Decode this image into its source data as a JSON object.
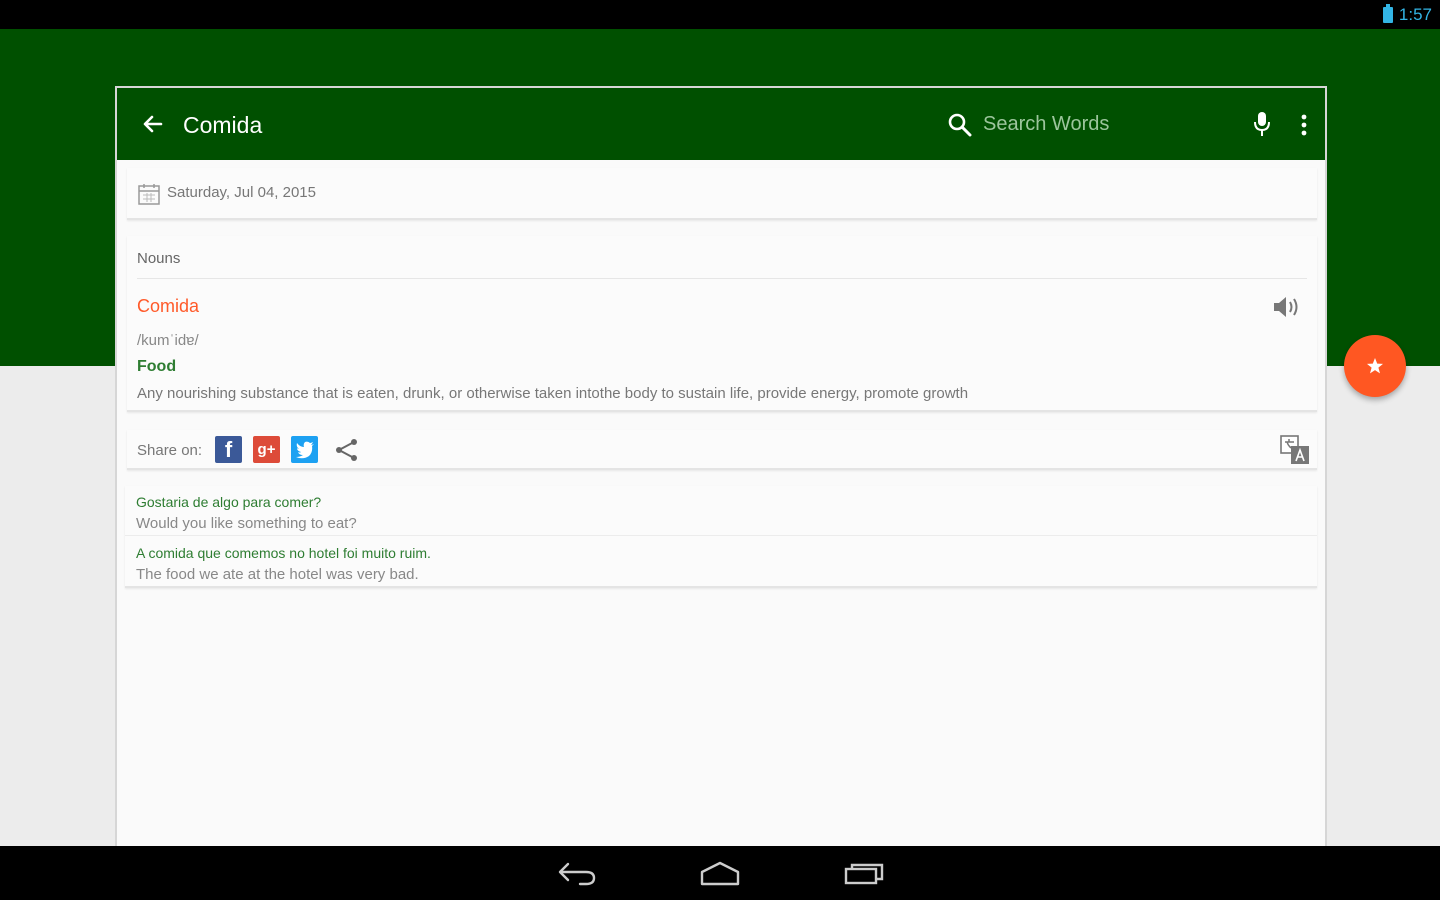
{
  "status_bar": {
    "time": "1:57"
  },
  "toolbar": {
    "title": "Comida",
    "search_placeholder": "Search Words",
    "color": "#005000"
  },
  "date_row": {
    "date": "Saturday, Jul 04, 2015"
  },
  "entry": {
    "part_of_speech": "Nouns",
    "word": "Comida",
    "phonetic": "/kumˈidɐ/",
    "translation": "Food",
    "definition": "Any nourishing substance that is eaten, drunk, or otherwise taken intothe body to sustain life, provide energy, promote growth",
    "word_color": "#ff5a2a",
    "translation_color": "#2e7d32"
  },
  "share": {
    "label": "Share on:",
    "facebook_glyph": "f",
    "google_glyph": "g+"
  },
  "examples": [
    {
      "pt": "Gostaria de algo para comer?",
      "en": "Would you like something to eat?"
    },
    {
      "pt": "A comida que comemos no hotel foi muito ruim.",
      "en": "The food we ate at the hotel was very bad."
    }
  ],
  "fab": {
    "icon": "star-icon",
    "color": "#ff5722"
  }
}
